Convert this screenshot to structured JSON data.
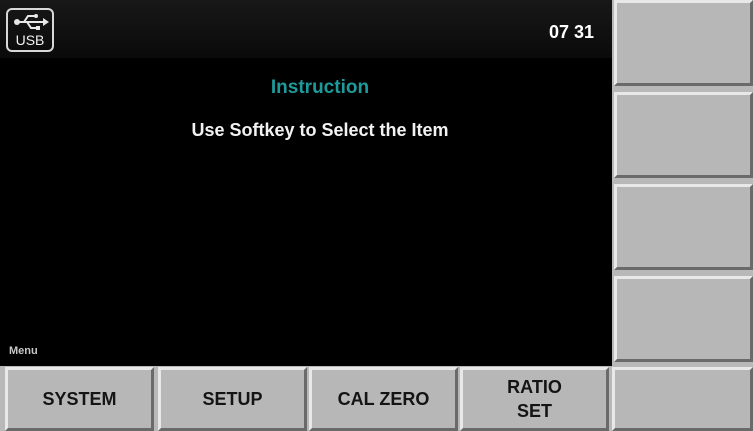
{
  "status_bar": {
    "usb_icon": "usb-icon",
    "usb_label": "USB",
    "time": "07 31"
  },
  "content": {
    "title": "Instruction",
    "message": "Use Softkey to Select the Item",
    "title_color": "#1e9a9a"
  },
  "menu": {
    "caption": "Menu"
  },
  "bottom_softkeys": [
    {
      "label": "SYSTEM"
    },
    {
      "label": "SETUP"
    },
    {
      "label": "CAL ZERO"
    },
    {
      "label": "RATIO\nSET"
    },
    {
      "label": ""
    }
  ],
  "side_softkeys": [
    {
      "label": ""
    },
    {
      "label": ""
    },
    {
      "label": ""
    },
    {
      "label": ""
    }
  ],
  "colors": {
    "screen_background": "#000000",
    "softkey_face": "#b7b7b7",
    "softkey_text": "#141414"
  }
}
